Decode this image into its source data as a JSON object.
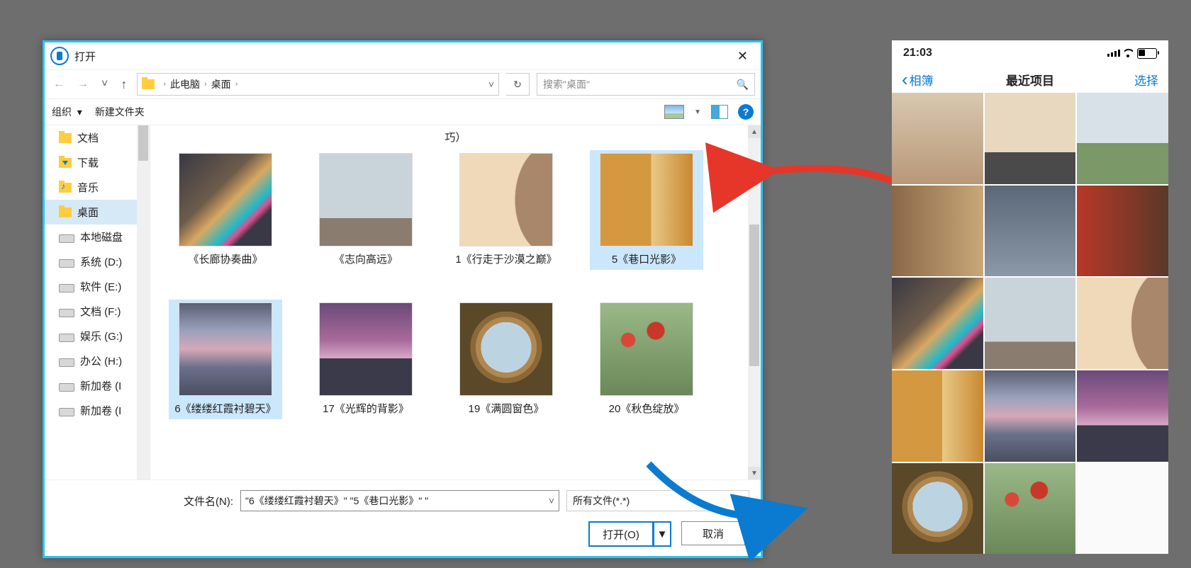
{
  "dialog": {
    "title": "打开",
    "breadcrumb": {
      "root": "此电脑",
      "folder": "桌面"
    },
    "search_placeholder": "搜索\"桌面\"",
    "organize": "组织",
    "new_folder": "新建文件夹",
    "header_fragment": "巧）",
    "filename_label": "文件名(N):",
    "filename_value": "\"6《缕缕红霞衬碧天》\" \"5《巷口光影》\" \"",
    "filetype": "所有文件(*.*)",
    "open_btn": "打开(O)",
    "cancel_btn": "取消"
  },
  "sidebar": [
    {
      "label": "文档",
      "kind": "folder"
    },
    {
      "label": "下载",
      "kind": "dl"
    },
    {
      "label": "音乐",
      "kind": "music"
    },
    {
      "label": "桌面",
      "kind": "folder",
      "selected": true
    },
    {
      "label": "本地磁盘",
      "kind": "drive"
    },
    {
      "label": "系统 (D:)",
      "kind": "drive"
    },
    {
      "label": "软件 (E:)",
      "kind": "drive"
    },
    {
      "label": "文档 (F:)",
      "kind": "drive"
    },
    {
      "label": "娱乐 (G:)",
      "kind": "drive"
    },
    {
      "label": "办公 (H:)",
      "kind": "drive"
    },
    {
      "label": "新加卷 (I",
      "kind": "drive"
    },
    {
      "label": "新加卷 (I",
      "kind": "drive"
    }
  ],
  "files": [
    {
      "caption": "《长廊协奏曲》",
      "thumb": "t1",
      "selected": false
    },
    {
      "caption": "《志向高远》",
      "thumb": "t2",
      "selected": false
    },
    {
      "caption": "1《行走于沙漠之巅》",
      "thumb": "t3",
      "selected": false
    },
    {
      "caption": "5《巷口光影》",
      "thumb": "t4",
      "selected": true
    },
    {
      "caption": "6《缕缕红霞衬碧天》",
      "thumb": "t5",
      "selected": true
    },
    {
      "caption": "17《光辉的背影》",
      "thumb": "t6",
      "selected": false
    },
    {
      "caption": "19《满圆窗色》",
      "thumb": "t7",
      "selected": false
    },
    {
      "caption": "20《秋色绽放》",
      "thumb": "t8",
      "selected": false
    }
  ],
  "phone": {
    "time": "21:03",
    "back": "相簿",
    "title": "最近项目",
    "select": "选择",
    "thumbs": [
      "p1",
      "p2",
      "p3",
      "p4",
      "p5",
      "p6",
      "t1",
      "t2",
      "t3",
      "t4",
      "t5",
      "t6",
      "t7",
      "t8",
      "p13"
    ]
  }
}
